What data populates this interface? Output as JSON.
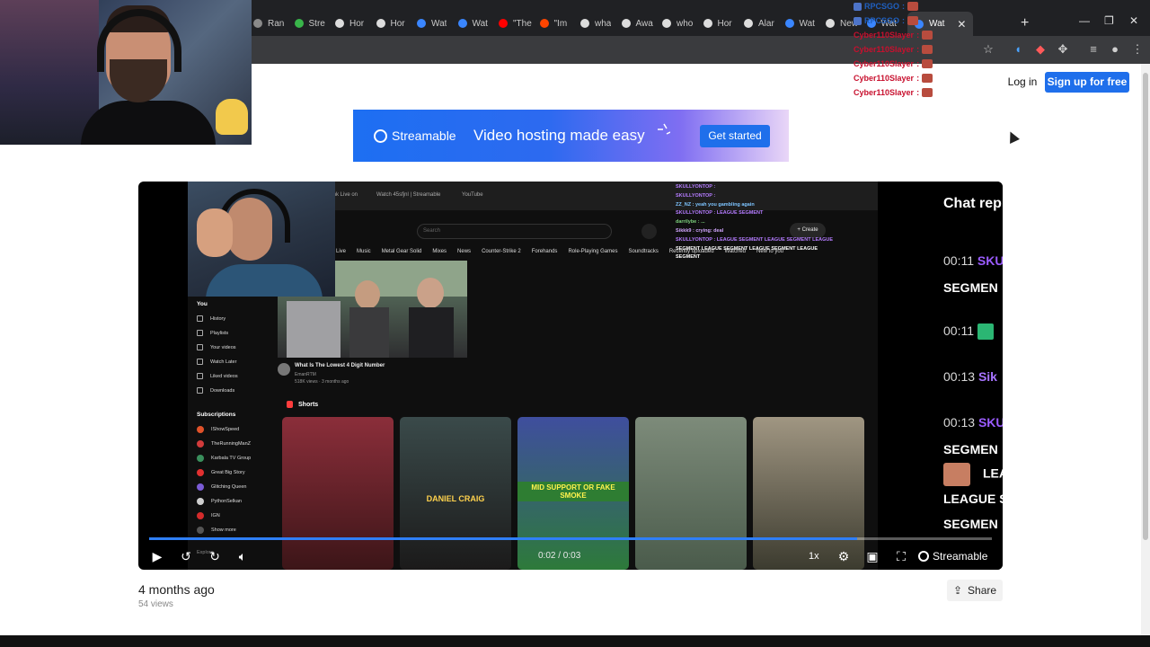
{
  "browser": {
    "tabs": [
      {
        "label": "Ran",
        "icon": "globe-icon",
        "color": "#8a8a8a"
      },
      {
        "label": "Stre",
        "icon": "chart-icon",
        "color": "#39b54a"
      },
      {
        "label": "Hor",
        "icon": "x-icon",
        "color": "#dddddd"
      },
      {
        "label": "Hor",
        "icon": "x-icon",
        "color": "#dddddd"
      },
      {
        "label": "Wat",
        "icon": "streamable-icon",
        "color": "#3a86ff"
      },
      {
        "label": "Wat",
        "icon": "streamable-icon",
        "color": "#3a86ff"
      },
      {
        "label": "\"The",
        "icon": "youtube-icon",
        "color": "#ff0000"
      },
      {
        "label": "\"Im",
        "icon": "reddit-icon",
        "color": "#ff4500"
      },
      {
        "label": "wha",
        "icon": "google-icon",
        "color": "#dddddd"
      },
      {
        "label": "Awa",
        "icon": "x-icon",
        "color": "#dddddd"
      },
      {
        "label": "who",
        "icon": "google-icon",
        "color": "#dddddd"
      },
      {
        "label": "Hor",
        "icon": "x-icon",
        "color": "#dddddd"
      },
      {
        "label": "Alar",
        "icon": "x-icon",
        "color": "#dddddd"
      },
      {
        "label": "Wat",
        "icon": "streamable-icon",
        "color": "#3a86ff"
      },
      {
        "label": "New",
        "icon": "openai-icon",
        "color": "#dddddd"
      },
      {
        "label": "Wat",
        "icon": "streamable-icon",
        "color": "#3a86ff"
      },
      {
        "label": "Wat",
        "icon": "streamable-icon",
        "color": "#3a86ff"
      }
    ],
    "active_tab_index": 16
  },
  "overlay_chat": {
    "lines": [
      {
        "user": "RPCSGO",
        "color": "#1f5fbf"
      },
      {
        "user": "RPCSGO",
        "color": "#1f5fbf"
      },
      {
        "user": "Cyber110Slayer",
        "color": "#c8102e"
      },
      {
        "user": "Cyber110Slayer",
        "color": "#c8102e"
      },
      {
        "user": "Cyber110Slayer",
        "color": "#c8102e"
      },
      {
        "user": "Cyber110Slayer",
        "color": "#c8102e"
      },
      {
        "user": "Cyber110Slayer",
        "color": "#c8102e"
      }
    ],
    "separator": ":"
  },
  "header": {
    "login": "Log in",
    "signup": "Sign up for free",
    "accent": "#1f6feb"
  },
  "banner": {
    "brand": "Streamable",
    "tagline": "Video hosting made easy",
    "cta": "Get started"
  },
  "video": {
    "inner_tabs": [
      "Link Live on",
      "Watch 45sfjnl | Streamable",
      "YouTube"
    ],
    "search_placeholder": "Search",
    "create": "+ Create",
    "chips": [
      "Live",
      "Music",
      "Metal Gear Solid",
      "Mixes",
      "News",
      "Counter-Strike 2",
      "Forehands",
      "Role-Playing Games",
      "Soundtracks",
      "Recently uploaded",
      "Watched",
      "New to you"
    ],
    "sidebar": {
      "you": "You",
      "items": [
        "History",
        "Playlists",
        "Your videos",
        "Watch Later",
        "Liked videos",
        "Downloads"
      ],
      "subscriptions_label": "Subscriptions",
      "subs": [
        {
          "name": "IShowSpeed",
          "color": "#e0522a"
        },
        {
          "name": "TheRunningManZ",
          "color": "#d23b3b"
        },
        {
          "name": "Karbala TV Group",
          "color": "#3a8f5c"
        },
        {
          "name": "Great Big Story",
          "color": "#e23030"
        },
        {
          "name": "Glitching Queen",
          "color": "#7b5cd6"
        },
        {
          "name": "PythonSelkan",
          "color": "#cfcfcf"
        },
        {
          "name": "IGN",
          "color": "#d42b2b"
        },
        {
          "name": "Show more",
          "color": "#555555"
        }
      ],
      "explore": "Explore"
    },
    "featured": {
      "title": "What Is The Lowest 4 Digit Number",
      "channel": "EmanRTM",
      "meta": "518K views · 3 months ago"
    },
    "shorts_label": "Shorts",
    "shorts": [
      {
        "caption": "",
        "colors": [
          "#8b2e3a",
          "#3c1518"
        ]
      },
      {
        "caption": "DANIEL CRAIG",
        "colors": [
          "#3a4a4a",
          "#1b1a1a"
        ]
      },
      {
        "caption": "MID SUPPORT OR FAKE SMOKE",
        "colors": [
          "#3f4e9e",
          "#2d7a3a"
        ]
      },
      {
        "caption": "",
        "colors": [
          "#7d8b7a",
          "#4a5b4b"
        ]
      },
      {
        "caption": "",
        "colors": [
          "#a09682",
          "#3c3b2f"
        ]
      }
    ],
    "inner_chat": [
      {
        "text": "SKULLYONTOP :",
        "color": "#b57cff"
      },
      {
        "text": "SKULLYONTOP :",
        "color": "#b57cff"
      },
      {
        "text": "ZZ_NZ : yeah you gambling again",
        "color": "#7dc4ff"
      },
      {
        "text": "SKULLYONTOP : LEAGUE SEGMENT",
        "color": "#b57cff"
      },
      {
        "text": "darrilybe : ...",
        "color": "#7dd27d"
      },
      {
        "text": "Sikkk9 : crying: deal",
        "color": "#d2a6ff"
      },
      {
        "text": "SKULLYONTOP : LEAGUE SEGMENT  LEAGUE SEGMENT  LEAGUE",
        "color": "#b57cff"
      },
      {
        "text": "SEGMENT  LEAGUE SEGMENT  LEAGUE SEGMENT  LEAGUE",
        "color": "#ffffff"
      },
      {
        "text": "SEGMENT",
        "color": "#ffffff"
      }
    ],
    "chat_replay": {
      "title": "Chat repl",
      "lines": [
        {
          "time": "00:11",
          "user": "SKU",
          "user_color": "#9b5cff"
        },
        {
          "time": "",
          "user": "SEGMEN",
          "user_color": "#ffffff"
        },
        {
          "time": "00:11",
          "user": "",
          "user_color": "#2bb673"
        },
        {
          "time": "00:13",
          "user": "Sik",
          "user_color": "#a774ff"
        },
        {
          "time": "00:13",
          "user": "SKU",
          "user_color": "#9b5cff"
        },
        {
          "time": "",
          "user": "SEGMEN",
          "user_color": "#ffffff"
        },
        {
          "time": "",
          "user": "LEA",
          "user_color": "#ffffff"
        },
        {
          "time": "",
          "user": "LEAGUE S",
          "user_color": "#ffffff"
        },
        {
          "time": "",
          "user": "SEGMEN",
          "user_color": "#ffffff"
        }
      ]
    },
    "time": "0:02 / 0:03",
    "speed": "1x",
    "brand": "Streamable",
    "progress": 0.84,
    "progress_color": "#2f7ff7"
  },
  "meta": {
    "ago": "4 months ago",
    "views": "54 views",
    "share": "Share"
  }
}
